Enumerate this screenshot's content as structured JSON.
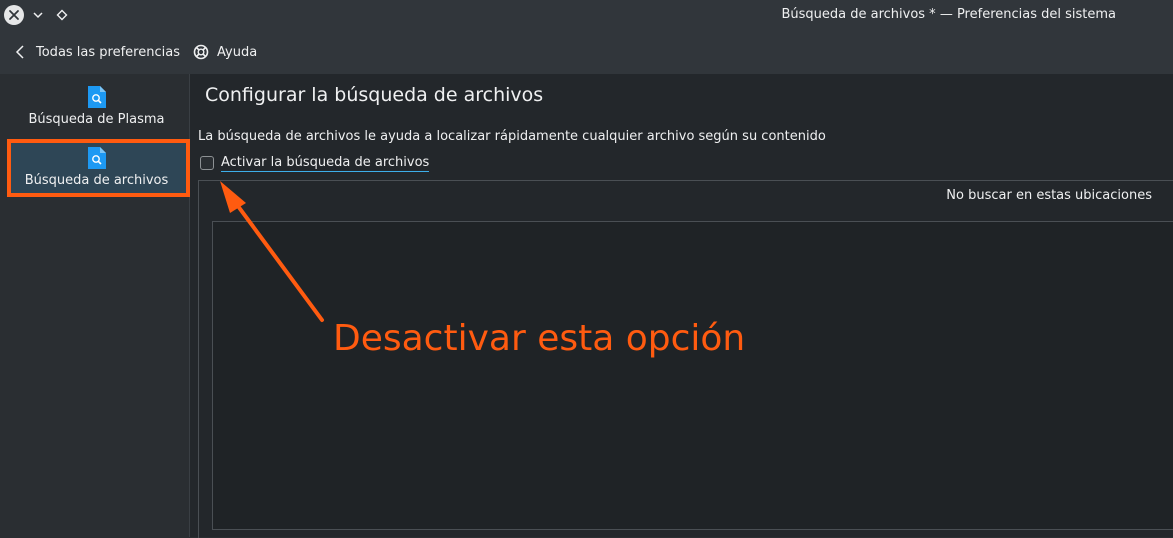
{
  "window": {
    "title": "Búsqueda de archivos * — Preferencias del sistema"
  },
  "toolbar": {
    "back_label": "Todas las preferencias",
    "help_label": "Ayuda"
  },
  "sidebar": {
    "items": [
      {
        "label": "Búsqueda de Plasma",
        "icon": "file-search-icon"
      },
      {
        "label": "Búsqueda de archivos",
        "icon": "file-search-icon",
        "active": true
      }
    ]
  },
  "main": {
    "title": "Configurar la búsqueda de archivos",
    "description": "La búsqueda de archivos le ayuda a localizar rápidamente cualquier archivo según su contenido",
    "checkbox": {
      "label": "Activar la búsqueda de archivos",
      "checked": false
    },
    "exclude_header": "No buscar en estas ubicaciones"
  },
  "annotation": {
    "text": "Desactivar esta opción",
    "color": "#ff5b10"
  },
  "colors": {
    "accent": "#3daee9",
    "highlight": "#ff5b10",
    "background": "#2a2e32"
  }
}
